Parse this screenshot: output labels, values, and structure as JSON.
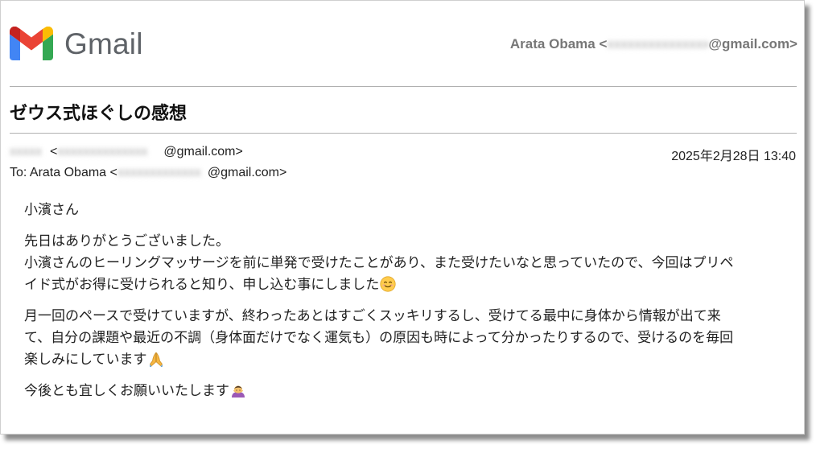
{
  "app": {
    "logo_text": "Gmail"
  },
  "account": {
    "name": "Arata Obama",
    "open_bracket": "<",
    "redacted": "xxxxxxxxxxxxxxx",
    "domain_suffix": "@gmail.com>"
  },
  "email": {
    "subject": "ゼウス式ほぐしの感想",
    "from": {
      "redacted_name": "xxxxx",
      "open_bracket": " <",
      "redacted_address": "xxxxxxxxxxxxxx",
      "domain_suffix": "@gmail.com>"
    },
    "date": "2025年2月28日 13:40",
    "to": {
      "prefix": "To: Arata Obama <",
      "redacted_address": "xxxxxxxxxxxxx",
      "domain_suffix": "@gmail.com>"
    },
    "body": {
      "greeting": "小濱さん",
      "p1_l1": "先日はありがとうございました。",
      "p1_l2": "小濱さんのヒーリングマッサージを前に単発で受けたことがあり、また受けたいなと思っていたので、今回はプリペ",
      "p1_l3": "イド式がお得に受けられると知り、申し込む事にしました",
      "p2_l1": "月一回のペースで受けていますが、終わったあとはすごくスッキリするし、受けてる最中に身体から情報が出て来",
      "p2_l2": "て、自分の課題や最近の不調（身体面だけでなく運気も）の原因も時によって分かったりするので、受けるのを毎回",
      "p2_l3": "楽しみにしています",
      "closing": "今後とも宜しくお願いいたします"
    }
  },
  "icons": {
    "logo": "gmail-m-icon",
    "smile": "smiling-face-emoji",
    "pray": "folded-hands-emoji",
    "bow": "person-bowing-emoji"
  },
  "colors": {
    "gmail_red": "#EA4335",
    "gmail_blue": "#4285F4",
    "gmail_green": "#34A853",
    "gmail_yellow": "#FBBC04",
    "gmail_darkred": "#C5221F"
  }
}
